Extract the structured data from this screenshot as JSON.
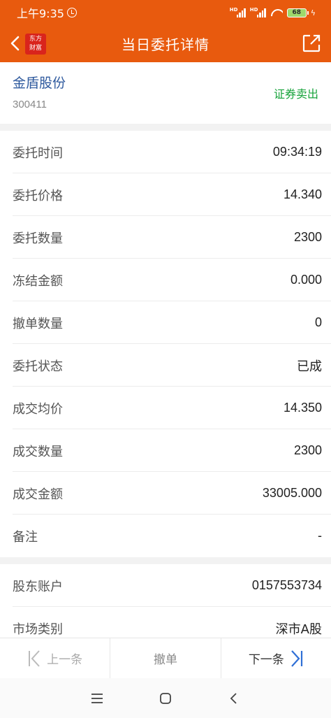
{
  "status_bar": {
    "time": "上午9:35",
    "signal1_hd": "HD",
    "signal2_hd": "HD",
    "battery": "68"
  },
  "navbar": {
    "logo_line1": "东方",
    "logo_line2": "财富",
    "title": "当日委托详情"
  },
  "stock": {
    "name": "金盾股份",
    "code": "300411",
    "direction": "证券卖出",
    "direction_color": "#17a33b"
  },
  "details": [
    {
      "label": "委托时间",
      "value": "09:34:19"
    },
    {
      "label": "委托价格",
      "value": "14.340"
    },
    {
      "label": "委托数量",
      "value": "2300"
    },
    {
      "label": "冻结金额",
      "value": "0.000"
    },
    {
      "label": "撤单数量",
      "value": "0"
    },
    {
      "label": "委托状态",
      "value": "已成"
    },
    {
      "label": "成交均价",
      "value": "14.350"
    },
    {
      "label": "成交数量",
      "value": "2300"
    },
    {
      "label": "成交金额",
      "value": "33005.000"
    },
    {
      "label": "备注",
      "value": "-"
    }
  ],
  "account": [
    {
      "label": "股东账户",
      "value": "0157553734"
    },
    {
      "label": "市场类别",
      "value": "深市A股"
    }
  ],
  "bottom_bar": {
    "prev": "上一条",
    "cancel": "撤单",
    "next": "下一条"
  },
  "colors": {
    "header": "#e85a0e",
    "accent_blue": "#2f6fd6"
  }
}
